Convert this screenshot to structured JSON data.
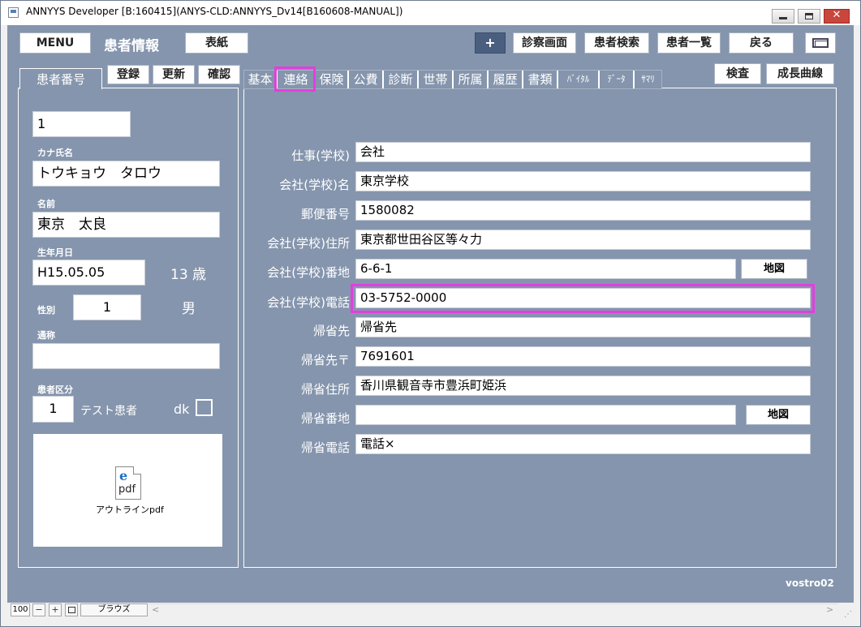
{
  "window": {
    "title": "ANNYYS Developer [B:160415](ANYS-CLD:ANNYYS_Dv14[B160608-MANUAL])",
    "min_icon": "minimize-icon",
    "max_icon": "maximize-icon",
    "close_glyph": "✕"
  },
  "toolbar": {
    "menu": "MENU",
    "screen_title": "患者情報",
    "cover": "表紙",
    "plus": "+",
    "exam_screen": "診察画面",
    "patient_search": "患者検索",
    "patient_list": "患者一覧",
    "back": "戻る"
  },
  "left": {
    "tab_label": "患者番号",
    "register": "登録",
    "update": "更新",
    "confirm": "確認",
    "patient_no": "1",
    "kana_label": "カナ氏名",
    "kana_value": "トウキョウ　タロウ",
    "name_label": "名前",
    "name_value": "東京　太良",
    "dob_label": "生年月日",
    "dob_value": "H15.05.05",
    "age_text": "13 歳",
    "sex_label": "性別",
    "sex_value": "1",
    "sex_text": "男",
    "alias_label": "通称",
    "alias_value": "",
    "category_label": "患者区分",
    "category_value": "1",
    "category_text": "テスト患者",
    "dk_label": "dk",
    "dk_checked": false,
    "pdf_icon_letter": "e",
    "pdf_icon_text": "pdf",
    "pdf_label": "アウトラインpdf"
  },
  "right": {
    "tabs": [
      "基本",
      "連絡",
      "保険",
      "公費",
      "診断",
      "世帯",
      "所属",
      "履歴",
      "書類",
      "ﾊﾞｲﾀﾙ",
      "ﾃﾞｰﾀ",
      "ｻﾏﾘ"
    ],
    "active_tab": "連絡",
    "exam": "検査",
    "growth": "成長曲線",
    "fields": [
      {
        "label": "仕事(学校)",
        "value": "会社"
      },
      {
        "label": "会社(学校)名",
        "value": "東京学校"
      },
      {
        "label": "郵便番号",
        "value": "1580082"
      },
      {
        "label": "会社(学校)住所",
        "value": "東京都世田谷区等々力"
      },
      {
        "label": "会社(学校)番地",
        "value": "6-6-1"
      },
      {
        "label": "会社(学校)電話",
        "value": "03-5752-0000"
      },
      {
        "label": "帰省先",
        "value": "帰省先"
      },
      {
        "label": "帰省先〒",
        "value": "7691601"
      },
      {
        "label": "帰省住所",
        "value": "香川県観音寺市豊浜町姫浜"
      },
      {
        "label": "帰省番地",
        "value": ""
      },
      {
        "label": "帰省電話",
        "value": "電話×"
      }
    ],
    "map_button": "地図"
  },
  "footer": {
    "user": "vostro02"
  },
  "statusbar": {
    "zoom": "100",
    "zoom_out": "−",
    "zoom_in": "+",
    "mode": "ブラウズ",
    "scroll_left": "<",
    "scroll_right": ">",
    "grip": "⋰"
  },
  "colors": {
    "panel_bg": "#8595ad",
    "highlight": "#e33ee0",
    "plus_button": "#4a5e80"
  }
}
